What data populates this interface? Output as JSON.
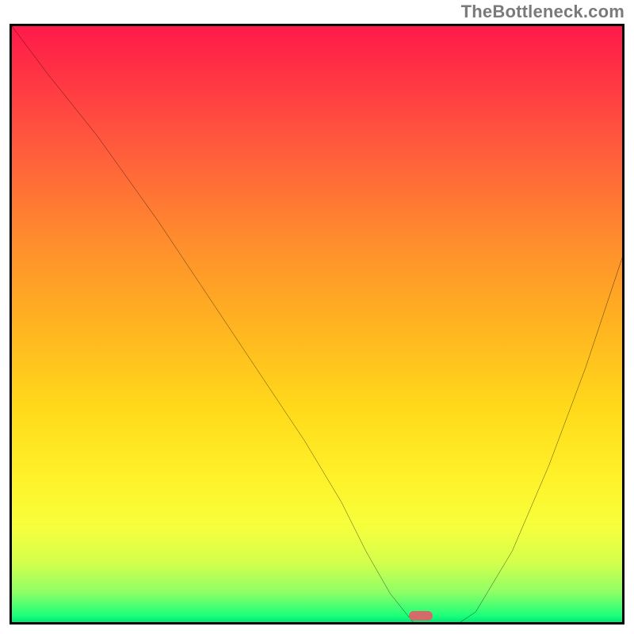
{
  "attribution": "TheBottleneck.com",
  "chart_data": {
    "type": "line",
    "title": "",
    "xlabel": "",
    "ylabel": "",
    "xlim": [
      0,
      100
    ],
    "ylim": [
      0,
      100
    ],
    "grid": false,
    "legend": false,
    "background_gradient": {
      "direction": "vertical",
      "stops": [
        {
          "pos": 0,
          "color": "#ff1a4a"
        },
        {
          "pos": 20,
          "color": "#ff5a3d"
        },
        {
          "pos": 50,
          "color": "#ffb321"
        },
        {
          "pos": 76,
          "color": "#fff22a"
        },
        {
          "pos": 95,
          "color": "#8eff66"
        },
        {
          "pos": 100,
          "color": "#00e676"
        }
      ]
    },
    "series": [
      {
        "name": "bottleneck-curve",
        "x": [
          0,
          6,
          14,
          24,
          32,
          40,
          48,
          54,
          58,
          62,
          66,
          70,
          76,
          82,
          88,
          94,
          100
        ],
        "y": [
          100,
          92,
          82,
          68,
          56,
          44,
          32,
          22,
          14,
          7,
          2,
          0,
          4,
          14,
          28,
          44,
          62
        ]
      }
    ],
    "marker": {
      "x": 67,
      "y": 0,
      "color": "#d46a6a",
      "shape": "pill"
    }
  }
}
